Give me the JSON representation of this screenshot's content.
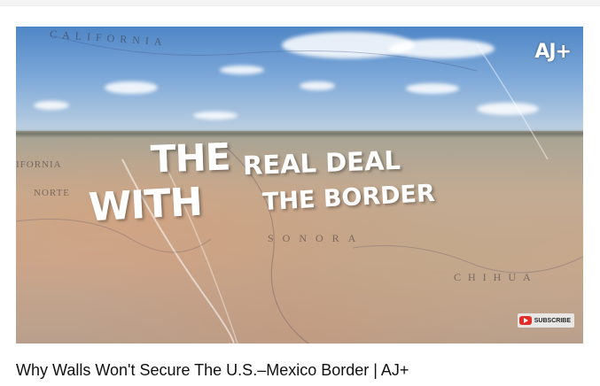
{
  "video": {
    "title": "Why Walls Won't Secure The U.S.–Mexico Border | AJ+",
    "headline_line1_big": "THE",
    "headline_line1_small": "REAL DEAL",
    "headline_line2_big": "WITH",
    "headline_line2_small": "THE BORDER",
    "channel_logo": "AJ+",
    "subscribe_label": "SUBSCRIBE",
    "subscribe_icon": "youtube-play-icon",
    "map_labels": [
      "CALIFORNIA",
      "IFORNIA",
      "NORTE",
      "SONORA",
      "CHIHUA"
    ]
  },
  "colors": {
    "headline": "#ffffff",
    "subscribe_icon": "#e52d27",
    "title_text": "#111111"
  }
}
